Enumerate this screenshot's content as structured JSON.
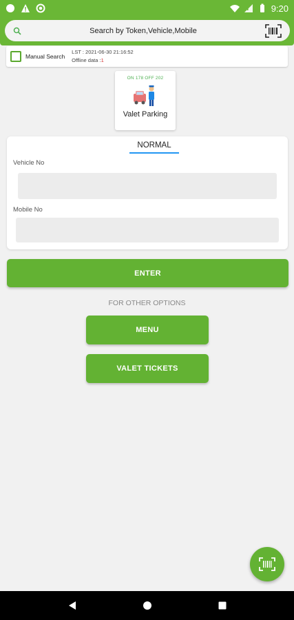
{
  "status_bar": {
    "time": "9:20",
    "left_icons": [
      "circle-icon",
      "warning-icon",
      "circle-dot-icon"
    ],
    "right_icons": [
      "wifi-icon",
      "signal-icon",
      "battery-icon"
    ]
  },
  "search": {
    "placeholder": "Search by Token,Vehicle,Mobile",
    "left_icon": "search-icon",
    "right_icon": "barcode-scan-icon"
  },
  "manual_search": {
    "label": "Manual Search",
    "checked": false,
    "lst_text": "LST : 2021-06-30 21:16:52",
    "offline_label": "Offline data :",
    "offline_value": "1"
  },
  "valet_card": {
    "stats": "ON 178 OFF 202",
    "label": "Valet Parking"
  },
  "form": {
    "tab_label": "NORMAL",
    "vehicle_label": "Vehicle No",
    "vehicle_value": "",
    "mobile_label": "Mobile No",
    "mobile_value": ""
  },
  "buttons": {
    "enter": "ENTER",
    "other_options": "FOR OTHER OPTIONS",
    "menu": "MENU",
    "valet_tickets": "VALET TICKETS"
  },
  "colors": {
    "primary": "#63b233",
    "status_bar": "#6ab736",
    "tab_underline": "#2196f3",
    "offline_value": "#d32f2f"
  }
}
